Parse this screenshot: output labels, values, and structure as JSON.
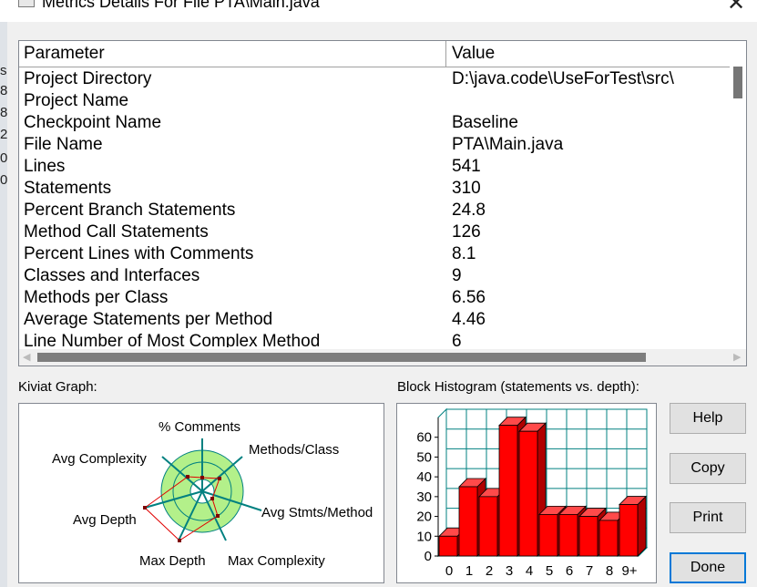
{
  "window": {
    "title": "Metrics Details For File  PTA\\Main.java",
    "close_glyph": "✕"
  },
  "left_strip_chars": [
    "s",
    "8",
    "8",
    "2",
    "0",
    "0"
  ],
  "table": {
    "headers": {
      "parameter": "Parameter",
      "value": "Value"
    },
    "rows": [
      {
        "parameter": "Project Directory",
        "value": "D:\\java.code\\UseForTest\\src\\"
      },
      {
        "parameter": "Project Name",
        "value": ""
      },
      {
        "parameter": "Checkpoint Name",
        "value": "Baseline"
      },
      {
        "parameter": "File Name",
        "value": "PTA\\Main.java"
      },
      {
        "parameter": "Lines",
        "value": "541"
      },
      {
        "parameter": "Statements",
        "value": "310"
      },
      {
        "parameter": "Percent Branch Statements",
        "value": "24.8"
      },
      {
        "parameter": "Method Call Statements",
        "value": "126"
      },
      {
        "parameter": "Percent Lines with Comments",
        "value": "8.1"
      },
      {
        "parameter": "Classes and Interfaces",
        "value": "9"
      },
      {
        "parameter": "Methods per Class",
        "value": "6.56"
      },
      {
        "parameter": "Average Statements per Method",
        "value": "4.46"
      },
      {
        "parameter": "Line Number of Most Complex Method",
        "value": "6"
      }
    ]
  },
  "kiviat": {
    "label": "Kiviat Graph:",
    "axes": [
      "% Comments",
      "Methods/Class",
      "Avg Stmts/Method",
      "Max Complexity",
      "Max Depth",
      "Avg Depth",
      "Avg Complexity"
    ],
    "ring_color": "#b3f08a"
  },
  "chart_data": {
    "type": "bar",
    "title": "Block Histogram (statements vs. depth):",
    "categories": [
      "0",
      "1",
      "2",
      "3",
      "4",
      "5",
      "6",
      "7",
      "8",
      "9+"
    ],
    "values": [
      10,
      35,
      30,
      66,
      63,
      21,
      21,
      20,
      18,
      26
    ],
    "yticks": [
      0,
      10,
      20,
      30,
      40,
      50,
      60
    ],
    "ylim": [
      0,
      70
    ],
    "grid": true,
    "bar_color": "#ff0000",
    "grid_color": "#008080"
  },
  "buttons": {
    "help": "Help",
    "copy": "Copy",
    "print": "Print",
    "done": "Done"
  }
}
